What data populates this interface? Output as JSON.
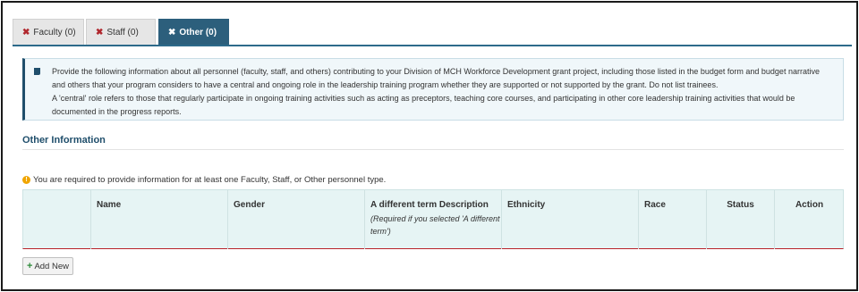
{
  "tabs": [
    {
      "label": "Faculty (0)",
      "icon": "x-icon",
      "active": false
    },
    {
      "label": "Staff (0)",
      "icon": "x-icon",
      "active": false
    },
    {
      "label": "Other (0)",
      "icon": "x-icon",
      "active": true
    }
  ],
  "info": {
    "paragraph1": "Provide the following information about all personnel (faculty, staff, and others) contributing to your Division of MCH Workforce Development grant project, including those listed in the budget form and budget narrative and others that your program considers to have a central and ongoing role in the leadership training program whether they are supported or not supported by the grant. Do not list trainees.",
    "paragraph2": "A 'central' role refers to those that regularly participate in ongoing training activities such as acting as preceptors, teaching core courses, and participating in other core leadership training activities that would be documented in the progress reports."
  },
  "section": {
    "title": "Other Information"
  },
  "notice": {
    "text": "You are required to provide information for at least one Faculty, Staff, or Other personnel type."
  },
  "table": {
    "columns": [
      {
        "label": "",
        "sub": ""
      },
      {
        "label": "Name",
        "sub": ""
      },
      {
        "label": "Gender",
        "sub": ""
      },
      {
        "label": "A different term Description",
        "sub": "(Required if you selected 'A different term')"
      },
      {
        "label": "Ethnicity",
        "sub": ""
      },
      {
        "label": "Race",
        "sub": ""
      },
      {
        "label": "Status",
        "sub": ""
      },
      {
        "label": "Action",
        "sub": ""
      }
    ]
  },
  "actions": {
    "add_new_label": "Add New"
  },
  "colors": {
    "tab_active": "#2c5f7c",
    "table_bg": "#e6f4f4",
    "remove_x": "#b0272d",
    "add_plus": "#2e8b3a"
  }
}
